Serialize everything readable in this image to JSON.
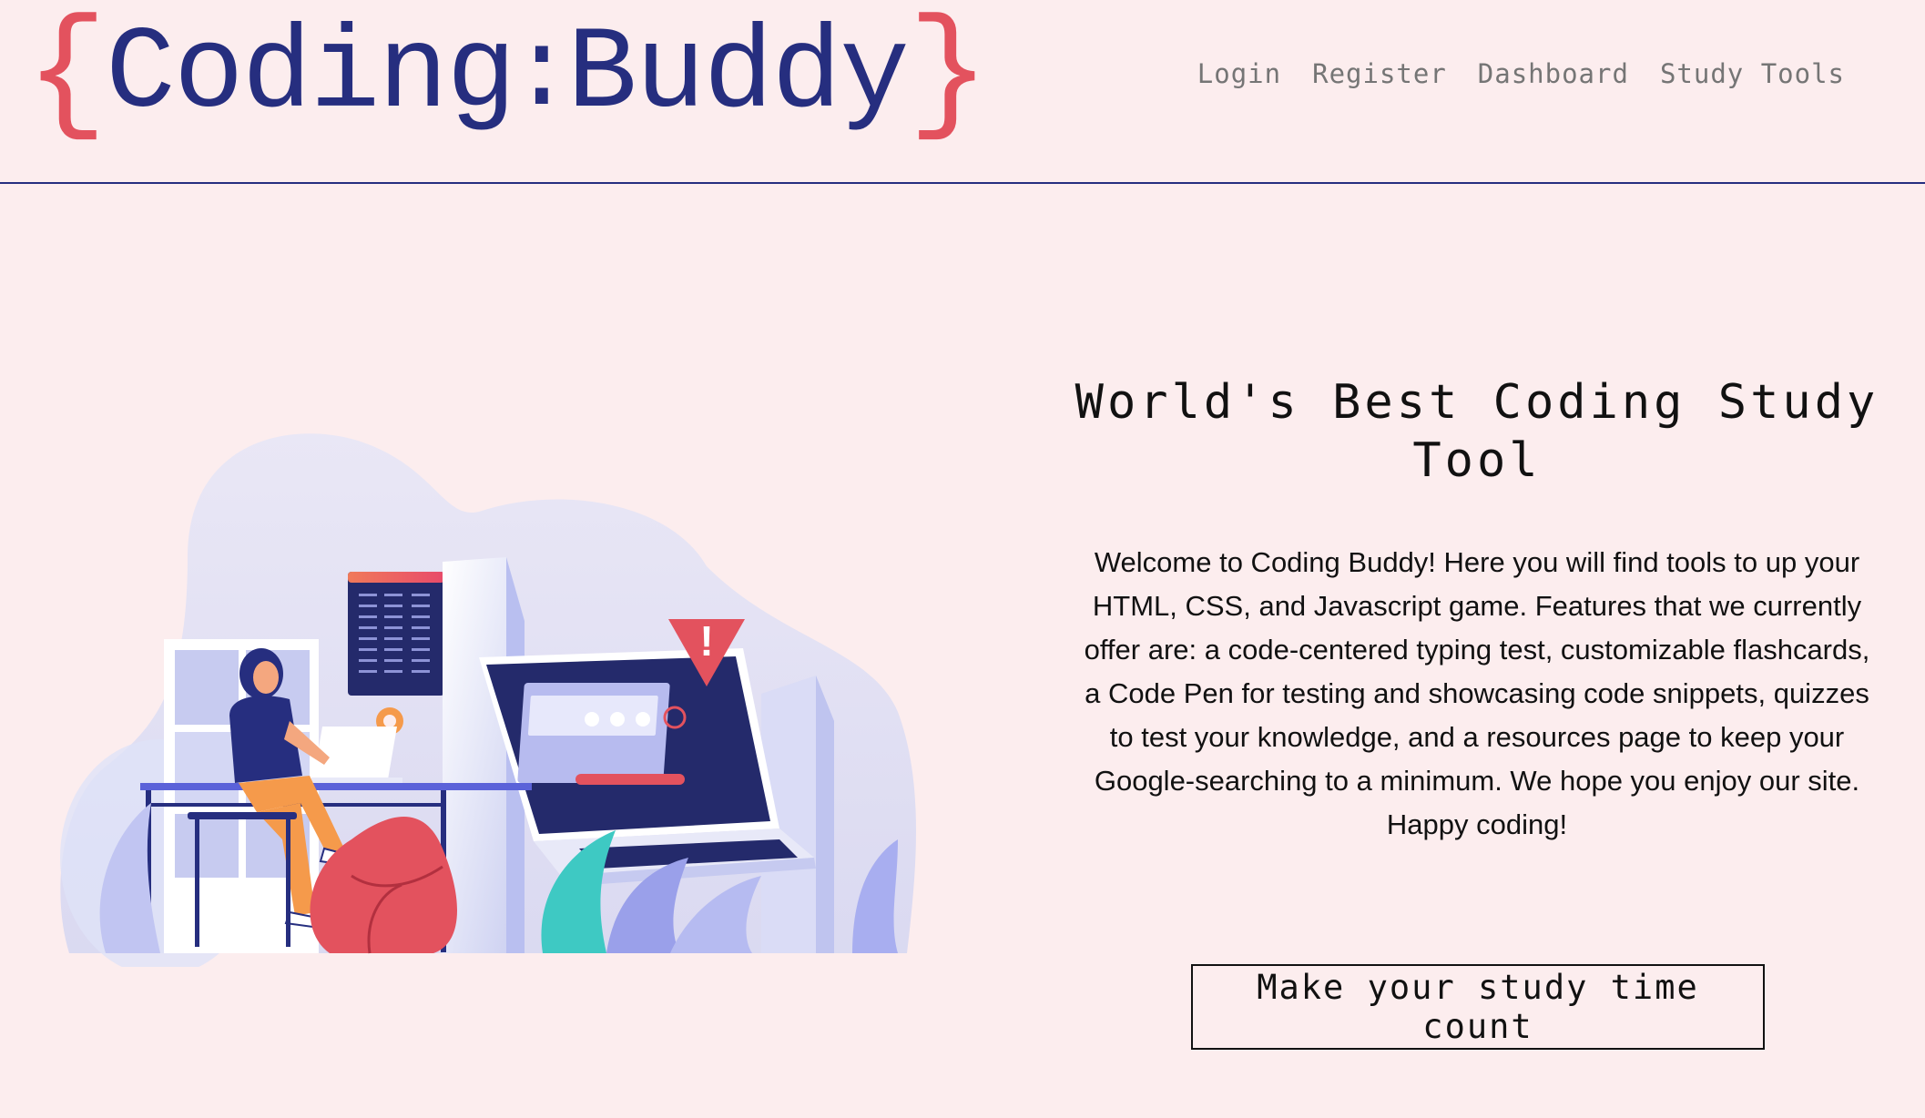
{
  "header": {
    "logo": {
      "open_brace": "{",
      "word1": "Coding",
      "colon": ":",
      "word2": "Buddy",
      "close_brace": "}"
    },
    "nav": [
      {
        "label": "Login"
      },
      {
        "label": "Register"
      },
      {
        "label": "Dashboard"
      },
      {
        "label": "Study Tools"
      }
    ]
  },
  "hero": {
    "title": "World's Best Coding Study Tool",
    "description": "Welcome to Coding Buddy! Here you will find tools to up your HTML, CSS, and Javascript game. Features that we currently offer are: a code-centered typing test, customizable flashcards, a Code Pen for testing and showcasing code snippets, quizzes to test your knowledge, and a resources page to keep your Google-searching to a minimum. We hope you enjoy our site. Happy coding!",
    "cta_label": "Make your study time count",
    "illustration_alert": "!"
  },
  "colors": {
    "background": "#fcedee",
    "brand_navy": "#262e7f",
    "brand_red": "#e3525e",
    "nav_text": "#757575"
  }
}
